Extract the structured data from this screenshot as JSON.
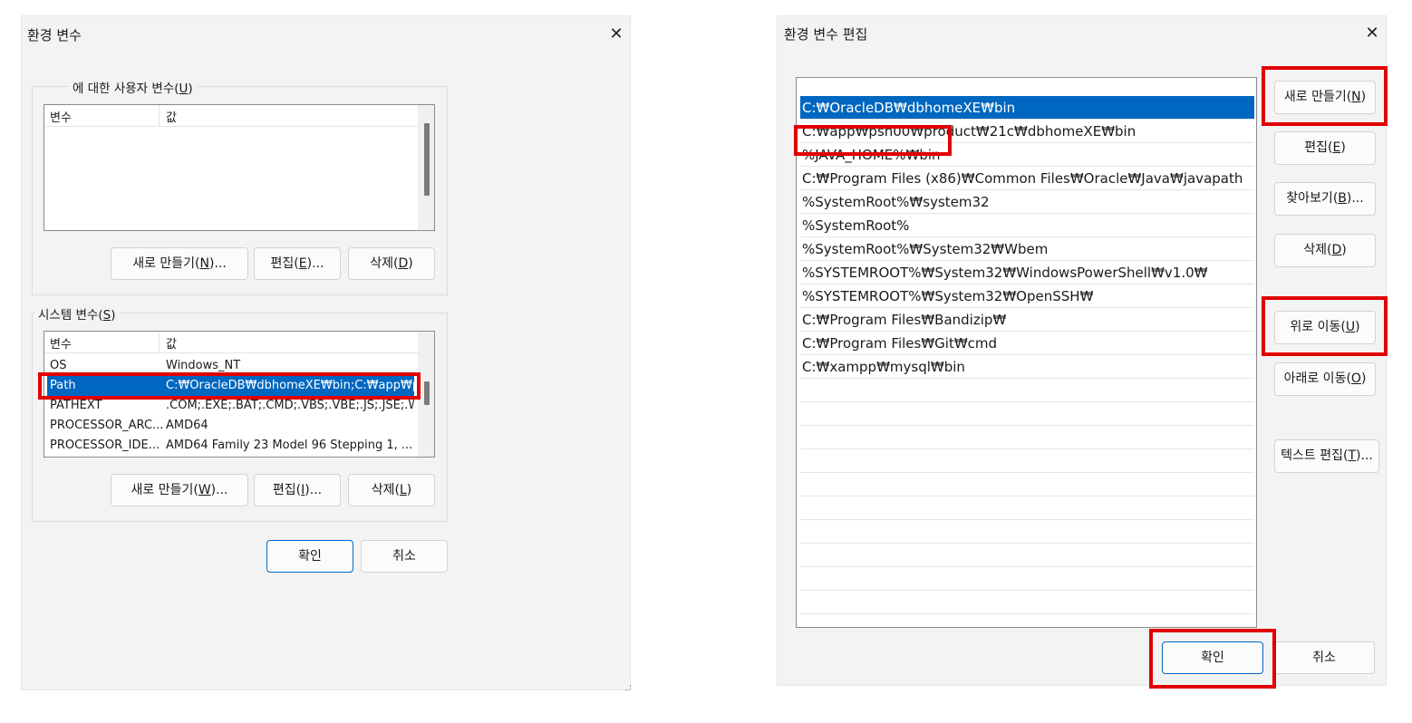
{
  "env_dialog": {
    "title": "환경 변수",
    "close": "✕",
    "user_group": {
      "label_prefix": "에 대한 사용자 변수(",
      "mnemonic": "U",
      "label_suffix": ")"
    },
    "columns": [
      "변수",
      "값"
    ],
    "user_buttons": [
      {
        "label": "새로 만들기(",
        "mnemonic": "N",
        "suffix": ")..."
      },
      {
        "label": "편집(",
        "mnemonic": "E",
        "suffix": ")..."
      },
      {
        "label": "삭제(",
        "mnemonic": "D",
        "suffix": ")"
      }
    ],
    "system_group": {
      "label_prefix": "시스템 변수(",
      "mnemonic": "S",
      "label_suffix": ")"
    },
    "system_rows": [
      {
        "name": "OS",
        "value": "Windows_NT"
      },
      {
        "name": "Path",
        "value": "C:₩OracleDB₩dbhomeXE₩bin;C:₩app₩p..."
      },
      {
        "name": "PATHEXT",
        "value": ".COM;.EXE;.BAT;.CMD;.VBS;.VBE;.JS;.JSE;.W..."
      },
      {
        "name": "PROCESSOR_ARC...",
        "value": "AMD64"
      },
      {
        "name": "PROCESSOR_IDE...",
        "value": "AMD64 Family 23 Model 96 Stepping 1, ..."
      }
    ],
    "system_buttons": [
      {
        "label": "새로 만들기(",
        "mnemonic": "W",
        "suffix": ")..."
      },
      {
        "label": "편집(",
        "mnemonic": "I",
        "suffix": ")..."
      },
      {
        "label": "삭제(",
        "mnemonic": "L",
        "suffix": ")"
      }
    ],
    "ok": "확인",
    "cancel": "취소"
  },
  "edit_dialog": {
    "title": "환경 변수 편집",
    "close": "✕",
    "paths": [
      "C:₩OracleDB₩dbhomeXE₩bin",
      "C:₩app₩psh00₩product₩21c₩dbhomeXE₩bin",
      "%JAVA_HOME%₩bin",
      "C:₩Program Files (x86)₩Common Files₩Oracle₩Java₩javapath",
      "%SystemRoot%₩system32",
      "%SystemRoot%",
      "%SystemRoot%₩System32₩Wbem",
      "%SYSTEMROOT%₩System32₩WindowsPowerShell₩v1.0₩",
      "%SYSTEMROOT%₩System32₩OpenSSH₩",
      "C:₩Program Files₩Bandizip₩",
      "C:₩Program Files₩Git₩cmd",
      "C:₩xampp₩mysql₩bin"
    ],
    "buttons": {
      "new": {
        "label": "새로 만들기(",
        "mnemonic": "N",
        "suffix": ")"
      },
      "edit": {
        "label": "편집(",
        "mnemonic": "E",
        "suffix": ")"
      },
      "browse": {
        "label": "찾아보기(",
        "mnemonic": "B",
        "suffix": ")..."
      },
      "delete": {
        "label": "삭제(",
        "mnemonic": "D",
        "suffix": ")"
      },
      "move_up": {
        "label": "위로 이동(",
        "mnemonic": "U",
        "suffix": ")"
      },
      "move_down": {
        "label": "아래로 이동(",
        "mnemonic": "O",
        "suffix": ")"
      },
      "edit_text": {
        "label": "텍스트 편집(",
        "mnemonic": "T",
        "suffix": ")..."
      }
    },
    "ok": "확인",
    "cancel": "취소"
  },
  "colors": {
    "selection": "#0067c0",
    "highlight": "#e10000",
    "dialog_bg": "#f3f3f3"
  }
}
